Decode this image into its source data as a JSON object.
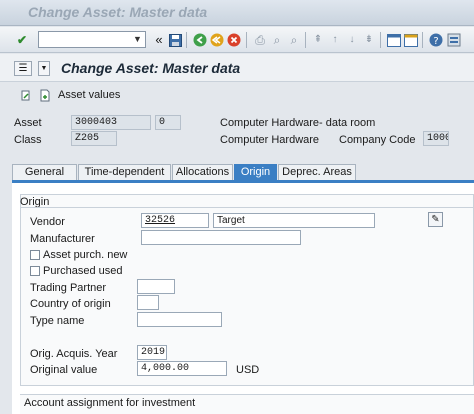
{
  "window": {
    "title": "Change Asset:  Master data"
  },
  "toolbar": {
    "command_value": "",
    "icons": [
      "check-icon",
      "save-icon",
      "back-icon",
      "exit-icon",
      "cancel-icon",
      "print-icon",
      "find-icon",
      "find-next-icon",
      "first-page-icon",
      "previous-page-icon",
      "next-page-icon",
      "last-page-icon",
      "create-session-icon",
      "shortcut-icon",
      "help-icon",
      "customize-icon"
    ]
  },
  "page": {
    "title": "Change Asset:  Master data",
    "asset_values_label": "Asset values"
  },
  "header": {
    "asset_label": "Asset",
    "asset_value": "3000403",
    "subnumber_value": "0",
    "asset_desc": "Computer Hardware- data room",
    "class_label": "Class",
    "class_value": "Z205",
    "class_desc": "Computer Hardware",
    "company_code_label": "Company Code",
    "company_code_value": "1000"
  },
  "tabs": [
    {
      "label": "General"
    },
    {
      "label": "Time-dependent"
    },
    {
      "label": "Allocations"
    },
    {
      "label": "Origin"
    },
    {
      "label": "Deprec. Areas"
    }
  ],
  "origin": {
    "group_title": "Origin",
    "vendor_label": "Vendor",
    "vendor_value": "32526",
    "vendor_name": "Target",
    "manufacturer_label": "Manufacturer",
    "manufacturer_value": "",
    "asset_purch_new_label": "Asset purch. new",
    "purchased_used_label": "Purchased used",
    "trading_partner_label": "Trading Partner",
    "trading_partner_value": "",
    "country_label": "Country of origin",
    "country_value": "",
    "type_name_label": "Type name",
    "type_name_value": "",
    "acquis_year_label": "Orig. Acquis. Year",
    "acquis_year_value": "2019",
    "orig_value_label": "Original value",
    "orig_value_value": "4,000.00",
    "currency": "USD"
  },
  "account_assignment": {
    "group_title": "Account assignment for investment"
  },
  "colors": {
    "active_tab": "#3b7fc4",
    "background": "#e3e7ec"
  }
}
